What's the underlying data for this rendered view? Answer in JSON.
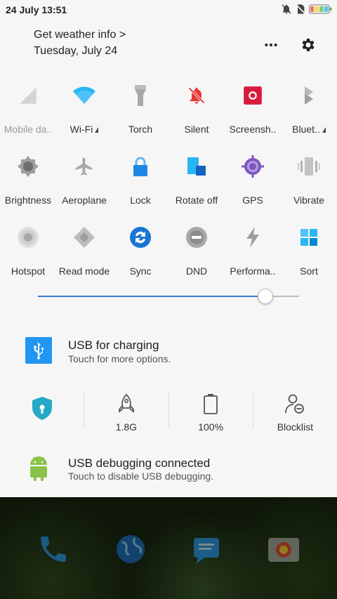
{
  "status_bar": {
    "time": "24 July  13:51",
    "icons": [
      "notifications-off-icon",
      "no-sim-icon",
      "battery-charging-icon"
    ]
  },
  "header": {
    "weather": "Get weather info >",
    "date": "Tuesday, July 24",
    "actions": [
      "more-icon",
      "settings-gear-icon"
    ]
  },
  "tiles": [
    {
      "label": "Mobile da..",
      "icon": "signal-icon"
    },
    {
      "label": "Wi-Fi",
      "icon": "wifi-icon"
    },
    {
      "label": "Torch",
      "icon": "torch-icon"
    },
    {
      "label": "Silent",
      "icon": "silent-bell-icon"
    },
    {
      "label": "Screensh..",
      "icon": "screenshot-icon"
    },
    {
      "label": "Bluet..",
      "icon": "bluetooth-icon"
    },
    {
      "label": "Brightness",
      "icon": "brightness-icon"
    },
    {
      "label": "Aeroplane",
      "icon": "aeroplane-icon"
    },
    {
      "label": "Lock",
      "icon": "lock-icon"
    },
    {
      "label": "Rotate off",
      "icon": "rotate-icon"
    },
    {
      "label": "GPS",
      "icon": "gps-icon"
    },
    {
      "label": "Vibrate",
      "icon": "vibrate-icon"
    },
    {
      "label": "Hotspot",
      "icon": "hotspot-icon"
    },
    {
      "label": "Read mode",
      "icon": "read-mode-icon"
    },
    {
      "label": "Sync",
      "icon": "sync-icon"
    },
    {
      "label": "DND",
      "icon": "dnd-icon"
    },
    {
      "label": "Performa..",
      "icon": "performance-icon"
    },
    {
      "label": "Sort",
      "icon": "sort-icon"
    }
  ],
  "brightness_level": 0.87,
  "usb_notification": {
    "title": "USB for charging",
    "subtitle": "Touch for more options."
  },
  "stats": [
    {
      "icon": "security-shield-icon",
      "value": ""
    },
    {
      "icon": "rocket-icon",
      "value": "1.8G"
    },
    {
      "icon": "battery-icon",
      "value": "100%"
    },
    {
      "icon": "blocklist-icon",
      "value": "Blocklist"
    }
  ],
  "debug_notification": {
    "title": "USB debugging connected",
    "subtitle": "Touch to disable USB debugging."
  },
  "dock": [
    "phone-icon",
    "browser-icon",
    "messages-icon",
    "camera-icon"
  ],
  "colors": {
    "accent": "#3a7bd5",
    "wifi": "#29b6f6",
    "silent": "#e53935",
    "screenshot": "#d81b3c",
    "gps": "#7e57c2",
    "android": "#8bc34a"
  }
}
